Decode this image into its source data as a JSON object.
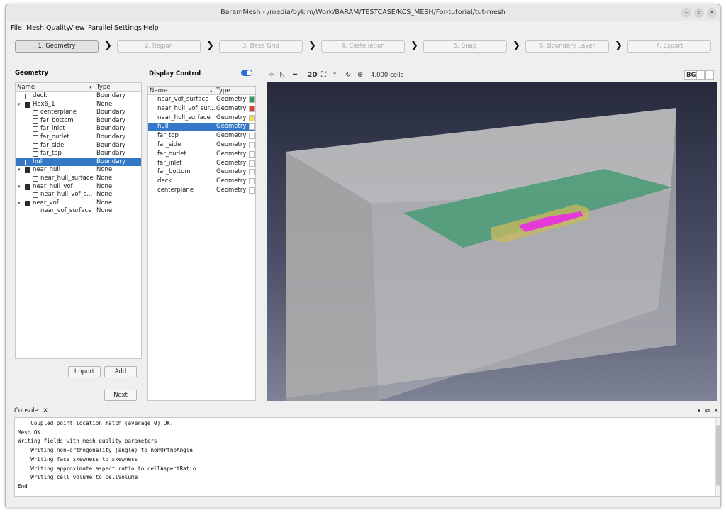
{
  "window": {
    "title": "BaramMesh - /media/bykim/Work/BARAM/TESTCASE/KCS_MESH/For-tutorial/tut-mesh"
  },
  "menu": [
    "File",
    "Mesh Quality",
    "View",
    "Parallel",
    "Settings",
    "Help"
  ],
  "steps": [
    "1. Geometry",
    "2. Region",
    "3. Base Grid",
    "4. Castellation",
    "5. Snap",
    "6. Boundary Layer",
    "7. Export"
  ],
  "geometry": {
    "title": "Geometry",
    "col_name": "Name",
    "col_type": "Type",
    "rows": [
      {
        "name": "deck",
        "type": "Boundary",
        "level": 0,
        "expand": "",
        "icon": "box"
      },
      {
        "name": "Hex6_1",
        "type": "None",
        "level": 0,
        "expand": "▾",
        "icon": "solid"
      },
      {
        "name": "centerplane",
        "type": "Boundary",
        "level": 1,
        "expand": "",
        "icon": "box"
      },
      {
        "name": "far_bottom",
        "type": "Boundary",
        "level": 1,
        "expand": "",
        "icon": "box"
      },
      {
        "name": "far_inlet",
        "type": "Boundary",
        "level": 1,
        "expand": "",
        "icon": "box"
      },
      {
        "name": "far_outlet",
        "type": "Boundary",
        "level": 1,
        "expand": "",
        "icon": "box"
      },
      {
        "name": "far_side",
        "type": "Boundary",
        "level": 1,
        "expand": "",
        "icon": "box"
      },
      {
        "name": "far_top",
        "type": "Boundary",
        "level": 1,
        "expand": "",
        "icon": "box"
      },
      {
        "name": "hull",
        "type": "Boundary",
        "level": 0,
        "expand": "",
        "icon": "box",
        "selected": true
      },
      {
        "name": "near_hull",
        "type": "None",
        "level": 0,
        "expand": "▾",
        "icon": "solid"
      },
      {
        "name": "near_hull_surface",
        "type": "None",
        "level": 1,
        "expand": "",
        "icon": "box"
      },
      {
        "name": "near_hull_vof",
        "type": "None",
        "level": 0,
        "expand": "▾",
        "icon": "solid"
      },
      {
        "name": "near_hull_vof_s...",
        "type": "None",
        "level": 1,
        "expand": "",
        "icon": "box"
      },
      {
        "name": "near_vof",
        "type": "None",
        "level": 0,
        "expand": "▾",
        "icon": "solid"
      },
      {
        "name": "near_vof_surface",
        "type": "None",
        "level": 1,
        "expand": "",
        "icon": "box"
      }
    ],
    "import_label": "Import",
    "add_label": "Add",
    "next_label": "Next"
  },
  "display": {
    "title": "Display Control",
    "col_name": "Name",
    "col_type": "Type",
    "rows": [
      {
        "name": "near_vof_surface",
        "type": "Geometry",
        "color": "#2e9a5c"
      },
      {
        "name": "near_hull_vof_sur...",
        "type": "Geometry",
        "color": "#d83a3a"
      },
      {
        "name": "near_hull_surface",
        "type": "Geometry",
        "color": "#e8dd5e"
      },
      {
        "name": "hull",
        "type": "Geometry",
        "color": "#ffffff",
        "selected": true
      },
      {
        "name": "far_top",
        "type": "Geometry",
        "color": "#ffffff"
      },
      {
        "name": "far_side",
        "type": "Geometry",
        "color": "#ffffff"
      },
      {
        "name": "far_outlet",
        "type": "Geometry",
        "color": "#ffffff"
      },
      {
        "name": "far_inlet",
        "type": "Geometry",
        "color": "#ffffff"
      },
      {
        "name": "far_bottom",
        "type": "Geometry",
        "color": "#ffffff"
      },
      {
        "name": "deck",
        "type": "Geometry",
        "color": "#ffffff"
      },
      {
        "name": "centerplane",
        "type": "Geometry",
        "color": "#ffffff"
      }
    ]
  },
  "viewer": {
    "mode_2d": "2D",
    "cells": "4,000 cells",
    "bg_label": "BG",
    "colors": {
      "box": "#bcbcbc",
      "plane": "#4d9c78",
      "near_box": "#c9b95c",
      "hull": "#e53ad6"
    }
  },
  "console": {
    "tab_label": "Console",
    "lines": [
      "    Coupled point location match (average 0) OK.",
      "Mesh OK.",
      "Writing fields with mesh quality parameters",
      "    Writing non-orthogonality (angle) to nonOrthoAngle",
      "    Writing face skewness to skewness",
      "    Writing approximate aspect ratio to cellAspectRatio",
      "    Writing cell volume to cellVolume",
      "End"
    ]
  }
}
